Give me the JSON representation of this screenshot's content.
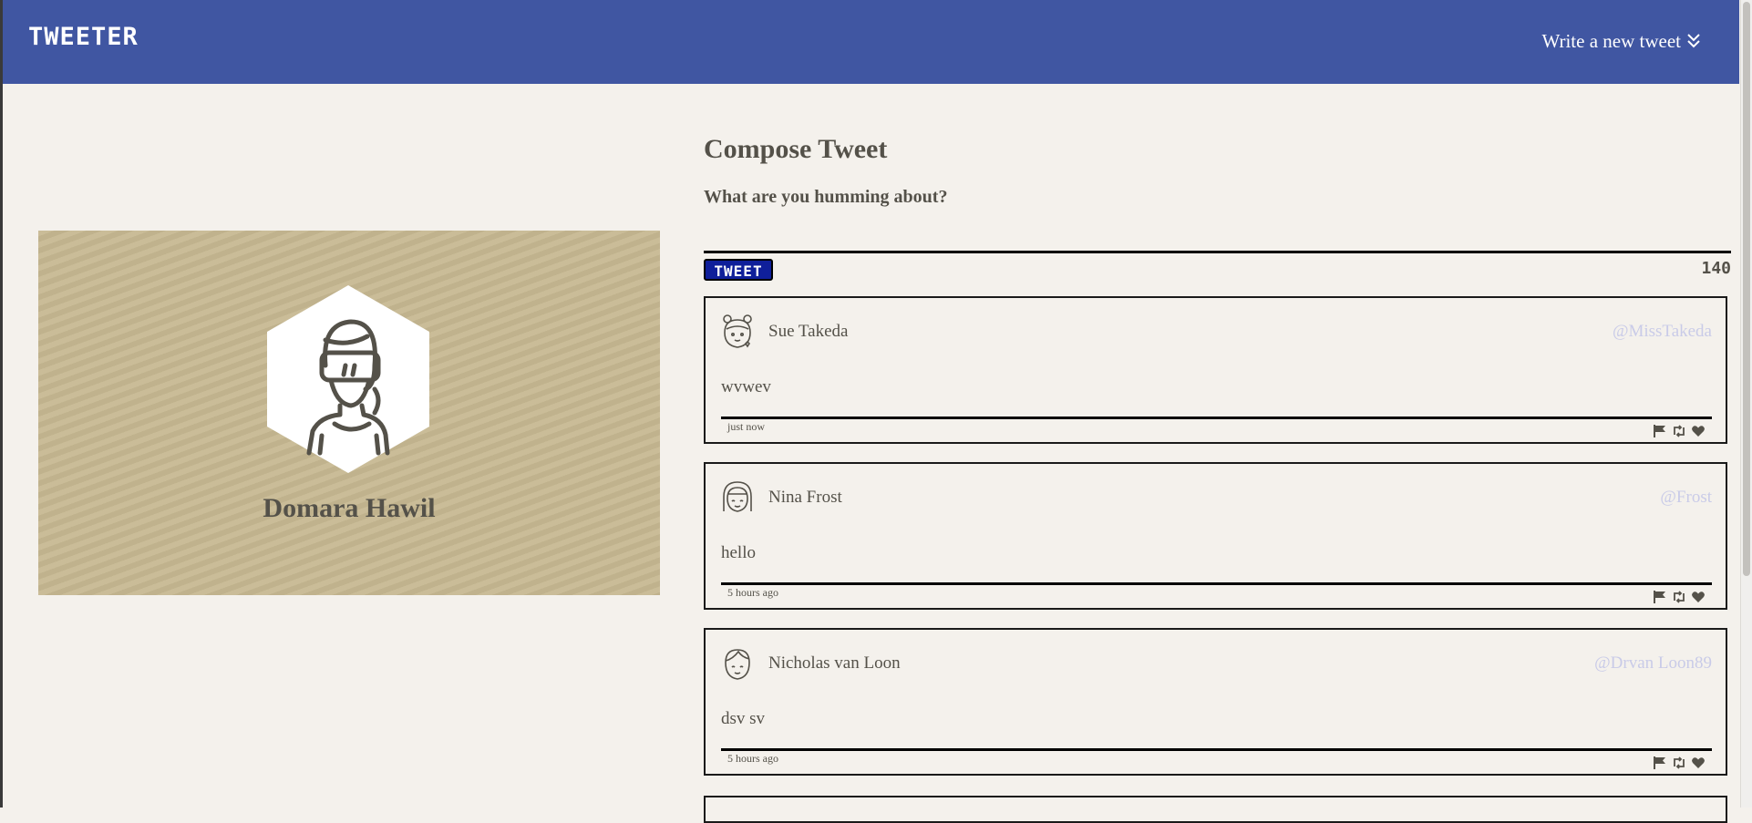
{
  "nav": {
    "brand": "TWEETER",
    "toggle_label": "Write a new tweet",
    "toggle_icon": "double-chevron-down-icon"
  },
  "profile": {
    "name": "Domara Hawil",
    "avatar_icon": "user-avatar-icon",
    "background_color": "#c7b992"
  },
  "compose": {
    "title": "Compose Tweet",
    "prompt": "What are you humming about?",
    "button_label": "TWEET",
    "counter": "140"
  },
  "tweets": [
    {
      "author": "Sue Takeda",
      "handle": "@MissTakeda",
      "content": "wvwev",
      "time": "just now"
    },
    {
      "author": "Nina Frost",
      "handle": "@Frost",
      "content": "hello",
      "time": "5 hours ago"
    },
    {
      "author": "Nicholas van Loon",
      "handle": "@Drvan Loon89",
      "content": "dsv sv",
      "time": "5 hours ago"
    }
  ],
  "tweet_actions": [
    "flag-icon",
    "retweet-icon",
    "heart-icon"
  ],
  "colors": {
    "nav": "#4056a2",
    "page_bg": "#f4f1ec",
    "text": "#545149",
    "handle": "#c9cbe8",
    "tweet_button": "#0f1f9a"
  }
}
